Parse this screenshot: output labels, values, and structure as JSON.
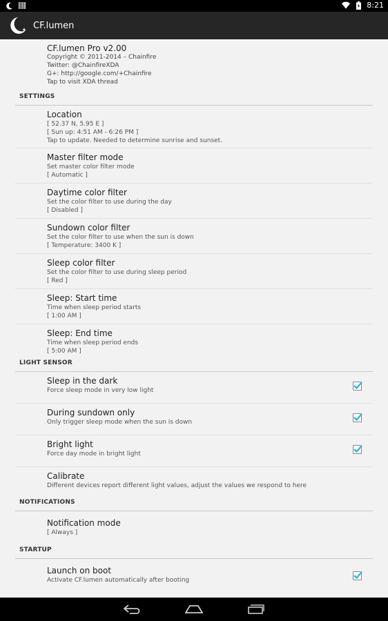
{
  "status_bar": {
    "time": "8:21",
    "left_icons": [
      "moon-icon",
      "barcode-icon"
    ],
    "right_icons": [
      "wifi-icon",
      "battery-icon"
    ]
  },
  "action_bar": {
    "title": "CF.lumen",
    "icon": "moon-star-icon"
  },
  "about": {
    "title": "CF.lumen Pro v2.00",
    "lines": [
      "Copyright © 2011-2014 – Chainfire",
      "Twitter: @ChainfireXDA",
      "G+: http://google.com/+Chainfire",
      "Tap to visit XDA thread"
    ]
  },
  "settings": {
    "header": "SETTINGS",
    "items": [
      {
        "title": "Location",
        "summary": [
          "[ 52.37 N, 5.95 E ]",
          "[ Sun up: 4:51 AM - 6:26 PM ]",
          "Tap to update. Needed to determine sunrise and sunset."
        ]
      },
      {
        "title": "Master filter mode",
        "summary": [
          "Set master color filter mode",
          "[ Automatic ]"
        ]
      },
      {
        "title": "Daytime color filter",
        "summary": [
          "Set the color filter to use during the day",
          "[ Disabled ]"
        ]
      },
      {
        "title": "Sundown color filter",
        "summary": [
          "Set the color filter to use when the sun is down",
          "[ Temperature: 3400 K ]"
        ]
      },
      {
        "title": "Sleep color filter",
        "summary": [
          "Set the color filter to use during sleep period",
          "[ Red ]"
        ]
      },
      {
        "title": "Sleep: Start time",
        "summary": [
          "Time when sleep period starts",
          "[ 1:00 AM ]"
        ]
      },
      {
        "title": "Sleep: End time",
        "summary": [
          "Time when sleep period ends",
          "[ 5:00 AM ]"
        ]
      }
    ]
  },
  "light_sensor": {
    "header": "LIGHT SENSOR",
    "items": [
      {
        "title": "Sleep in the dark",
        "summary": "Force sleep mode in very low light",
        "checked": true
      },
      {
        "title": "During sundown only",
        "summary": "Only trigger sleep mode when the sun is down",
        "checked": true
      },
      {
        "title": "Bright light",
        "summary": "Force day mode in bright light",
        "checked": true
      },
      {
        "title": "Calibrate",
        "summary": "Different devices report different light values, adjust the values we respond to here"
      }
    ]
  },
  "notifications": {
    "header": "NOTIFICATIONS",
    "items": [
      {
        "title": "Notification mode",
        "summary": "[ Always ]"
      }
    ]
  },
  "startup": {
    "header": "STARTUP",
    "items": [
      {
        "title": "Launch on boot",
        "summary": "Activate CF.lumen automatically after booting",
        "checked": true
      }
    ]
  },
  "nav_bar": {
    "buttons": [
      "back-icon",
      "home-icon",
      "recents-icon"
    ]
  },
  "colors": {
    "accent_check": "#33b5e5",
    "action_bar": "#262626",
    "background": "#f2f2f2"
  }
}
